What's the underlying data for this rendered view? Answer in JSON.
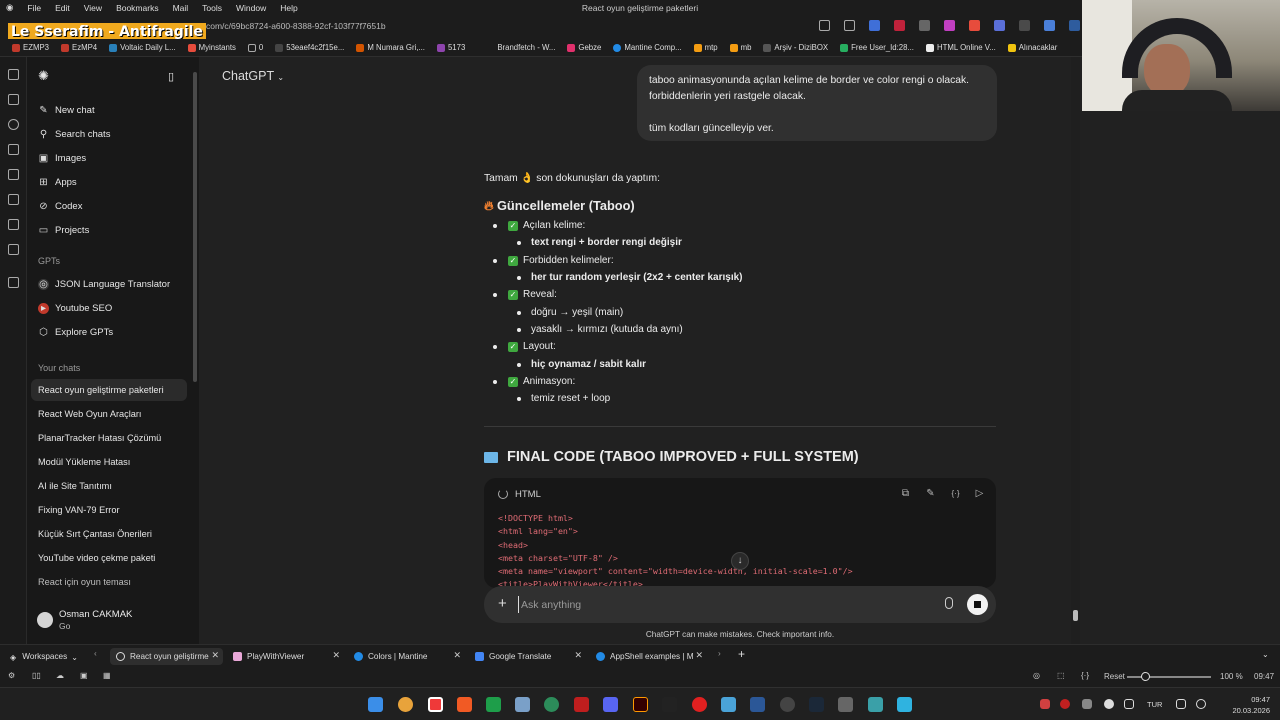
{
  "os_menu": {
    "items": [
      "File",
      "Edit",
      "View",
      "Bookmarks",
      "Mail",
      "Tools",
      "Window",
      "Help"
    ],
    "window_title": "React oyun geliştirme paketleri"
  },
  "overlay_title": "Le Sserafim - Antifragile",
  "address_bar": {
    "url": "hatgpt.com/c/69bc8724-a600-8388-92cf-103f77f7651b"
  },
  "bookmarks": [
    "EZMP3",
    "EzMP4",
    "Voltaic Daily L...",
    "Myinstants",
    "0",
    "53eaef4c2f15e...",
    "M Numara Gri,...",
    "5173",
    "Brandfetch - W...",
    "Gebze",
    "Mantine Comp...",
    "mtp",
    "mb",
    "Arşiv - DiziBOX",
    "Free User_Id:28...",
    "HTML Online V...",
    "Alınacaklar"
  ],
  "sidebar": {
    "new_chat": "New chat",
    "search_chats": "Search chats",
    "images": "Images",
    "apps": "Apps",
    "codex": "Codex",
    "projects": "Projects",
    "gpts_label": "GPTs",
    "gpts": [
      "JSON Language Translator",
      "Youtube SEO",
      "Explore GPTs"
    ],
    "your_chats_label": "Your chats",
    "chats": [
      "React oyun geliştirme paketleri",
      "React Web Oyun Araçları",
      "PlanarTracker Hatası Çözümü",
      "Modül Yükleme Hatası",
      "AI ile Site Tanıtımı",
      "Fixing VAN-79 Error",
      "Küçük Sırt Çantası Önerileri",
      "YouTube video çekme paketi",
      "React için oyun teması"
    ],
    "user": {
      "name": "Osman CAKMAK",
      "plan": "Go"
    }
  },
  "header": {
    "model": "ChatGPT"
  },
  "user_message": {
    "line1": "taboo animasyonunda açılan kelime de border ve color rengi o olacak.",
    "line2": "forbiddenlerin yeri rastgele olacak.",
    "line3": "tüm kodları güncelleyip ver."
  },
  "answer": {
    "intro": "Tamam 👌 son dokunuşları da yaptım:",
    "heading": "Güncellemeler (Taboo)",
    "items": [
      {
        "title": "Açılan kelime:",
        "subs": [
          "text rengi + border rengi değişir"
        ],
        "bold": true
      },
      {
        "title": "Forbidden kelimeler:",
        "subs": [
          "her tur random yerleşir (2x2 + center karışık)"
        ],
        "bold": true
      },
      {
        "title": "Reveal:",
        "subs": [
          "doğru → yeşil (main)",
          "yasaklı → kırmızı (kutuda da aynı)"
        ],
        "bold": false
      },
      {
        "title": "Layout:",
        "subs": [
          "hiç oynamaz / sabit kalır"
        ],
        "bold": true
      },
      {
        "title": "Animasyon:",
        "subs": [
          "temiz reset + loop"
        ],
        "bold": false
      }
    ],
    "final_heading": "FINAL CODE (TABOO IMPROVED + FULL SYSTEM)"
  },
  "code_block": {
    "language": "HTML",
    "lines": [
      "<!DOCTYPE html>",
      "<html lang=\"en\">",
      "<head>",
      "<meta charset=\"UTF-8\" />",
      "<meta name=\"viewport\" content=\"width=device-width, initial-scale=1.0\"/>",
      "<title>PlayWithViewer</title>"
    ]
  },
  "composer": {
    "placeholder": "Ask anything",
    "disclaimer": "ChatGPT can make mistakes. Check important info."
  },
  "tabs": {
    "workspaces": "Workspaces",
    "items": [
      "React oyun geliştirme",
      "PlayWithViewer",
      "Colors | Mantine",
      "Google Translate",
      "AppShell examples | M"
    ]
  },
  "statusbar": {
    "reset": "Reset",
    "zoom": "100 %",
    "time": "09:47"
  },
  "taskbar": {
    "lang": "TUR",
    "time": "09:47",
    "date": "20.03.2026"
  },
  "colors": {
    "accent_green": "#3fa83f",
    "background": "#212121",
    "sidebar": "#181818",
    "bubble": "#303030"
  }
}
